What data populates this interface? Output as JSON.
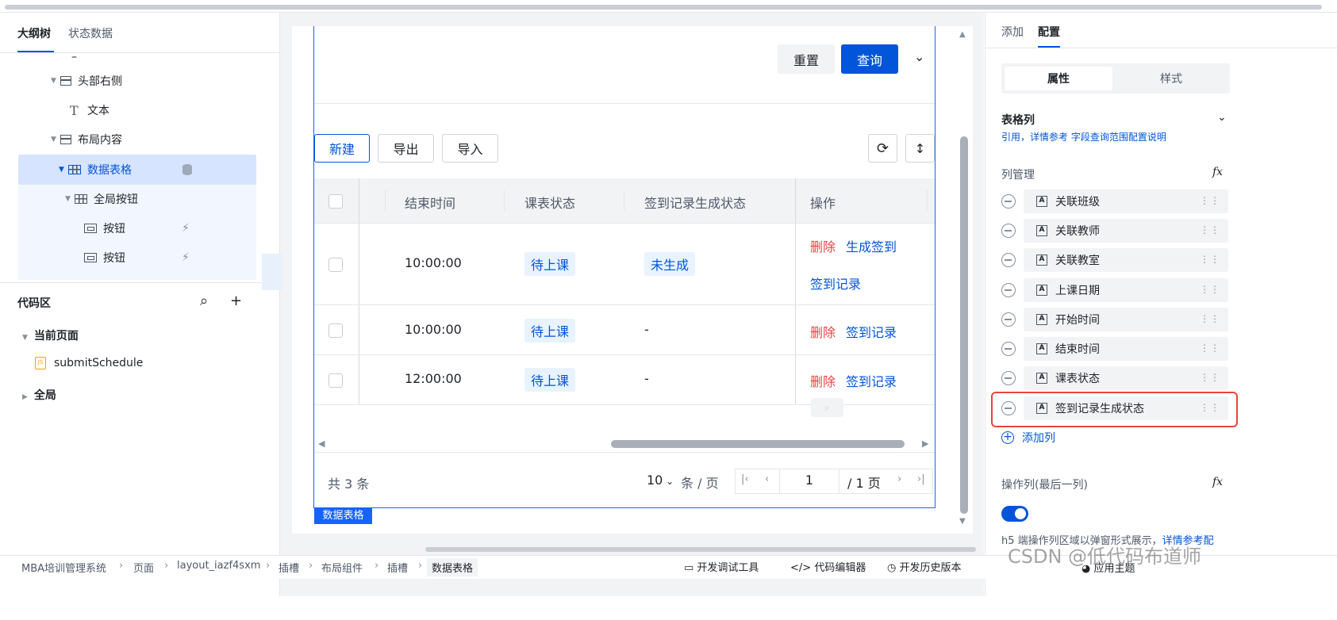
{
  "left_panel": {
    "tabs": [
      "大纲树",
      "状态数据"
    ],
    "tree": {
      "dash": "–",
      "header_right": "头部右侧",
      "text": "文本",
      "layout_content": "布局内容",
      "data_table": "数据表格",
      "global_buttons": "全局按钮",
      "button1": "按钮",
      "button2": "按钮"
    },
    "code_area": {
      "title": "代码区",
      "current_page": "当前页面",
      "file": "submitSchedule",
      "global": "全局"
    }
  },
  "canvas": {
    "reset_label": "重置",
    "query_label": "查询",
    "toolbar": {
      "new_label": "新建",
      "export_label": "导出",
      "import_label": "导入"
    },
    "table": {
      "headers": [
        "结束时间",
        "课表状态",
        "签到记录生成状态",
        "操作"
      ],
      "rows": [
        {
          "end_time": "10:00:00",
          "status": "待上课",
          "sign_status": "未生成",
          "actions": [
            "删除",
            "生成签到",
            "签到记录"
          ]
        },
        {
          "end_time": "10:00:00",
          "status": "待上课",
          "sign_status": "-",
          "actions": [
            "删除",
            "签到记录"
          ]
        },
        {
          "end_time": "12:00:00",
          "status": "待上课",
          "sign_status": "-",
          "actions": [
            "删除",
            "签到记录"
          ]
        }
      ]
    },
    "pagination": {
      "total": "共 3 条",
      "page_size": "10",
      "per_page": "条 / 页",
      "page": "1",
      "page_total": "/ 1 页"
    },
    "selection_label": "数据表格"
  },
  "right_panel": {
    "tabs": [
      "添加",
      "配置"
    ],
    "segments": [
      "属性",
      "样式"
    ],
    "section_title": "表格列",
    "hint_text": "引用，详情参考 字段查询范围配置说明",
    "column_manage": "列管理",
    "fx": "fx",
    "columns": [
      "关联班级",
      "关联教师",
      "关联教室",
      "上课日期",
      "开始时间",
      "结束时间",
      "课表状态",
      "签到记录生成状态"
    ],
    "add_column": "添加列",
    "action_column": "操作列(最后一列)",
    "h5_note": "h5 端操作列区域以弹窗形式展示，",
    "h5_link": "详情参考配"
  },
  "status_bar": {
    "breadcrumbs": [
      "MBA培训管理系统",
      "页面",
      "layout_iazf4sxm",
      "插槽",
      "布局组件",
      "插槽",
      "数据表格"
    ],
    "tools": [
      "开发调试工具",
      "代码编辑器",
      "开发历史版本",
      "应用主题"
    ],
    "watermark": "CSDN @低代码布道师"
  },
  "colors": {
    "primary": "#0055d9",
    "danger": "#f53f3f",
    "highlight": "#e8453c"
  }
}
